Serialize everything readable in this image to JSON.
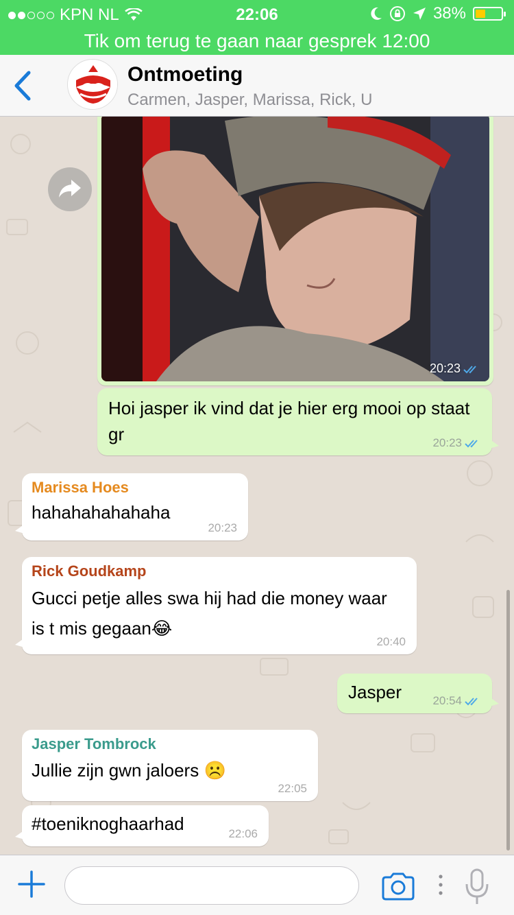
{
  "status_bar": {
    "carrier": "KPN NL",
    "time": "22:06",
    "battery_percent": "38%",
    "battery_level": 0.38
  },
  "call_banner": {
    "text": "Tik om terug te gaan naar gesprek 12:00"
  },
  "header": {
    "title": "Ontmoeting",
    "members": "Carmen, Jasper, Marissa, Rick, U",
    "avatar_text": "DE ONTMOETING"
  },
  "messages": [
    {
      "type": "image",
      "direction": "outgoing",
      "time": "20:23",
      "status": "read"
    },
    {
      "type": "text",
      "direction": "outgoing",
      "text": "Hoi jasper ik vind dat je hier erg mooi op staat gr",
      "time": "20:23",
      "status": "read"
    },
    {
      "type": "text",
      "direction": "incoming",
      "sender": "Marissa Hoes",
      "sender_color": "#e58a1f",
      "text": "hahahahahahaha",
      "time": "20:23"
    },
    {
      "type": "text",
      "direction": "incoming",
      "sender": "Rick Goudkamp",
      "sender_color": "#b5451b",
      "text": "Gucci petje alles swa hij had die money waar is t mis gegaan😂",
      "time": "20:40"
    },
    {
      "type": "text",
      "direction": "outgoing",
      "text": "Jasper",
      "time": "20:54",
      "status": "read"
    },
    {
      "type": "text",
      "direction": "incoming",
      "sender": "Jasper Tombrock",
      "sender_color": "#3a9b8c",
      "text": "Jullie zijn gwn jaloers ☹️",
      "time": "22:05"
    },
    {
      "type": "text",
      "direction": "incoming",
      "text": "#toeniknoghaarhad",
      "time": "22:06"
    }
  ],
  "input_bar": {
    "placeholder": ""
  },
  "colors": {
    "status_green": "#4cd964",
    "outgoing_bubble": "#dcf8c6",
    "ios_blue": "#1a7bd8",
    "read_tick": "#4fa9e8"
  }
}
